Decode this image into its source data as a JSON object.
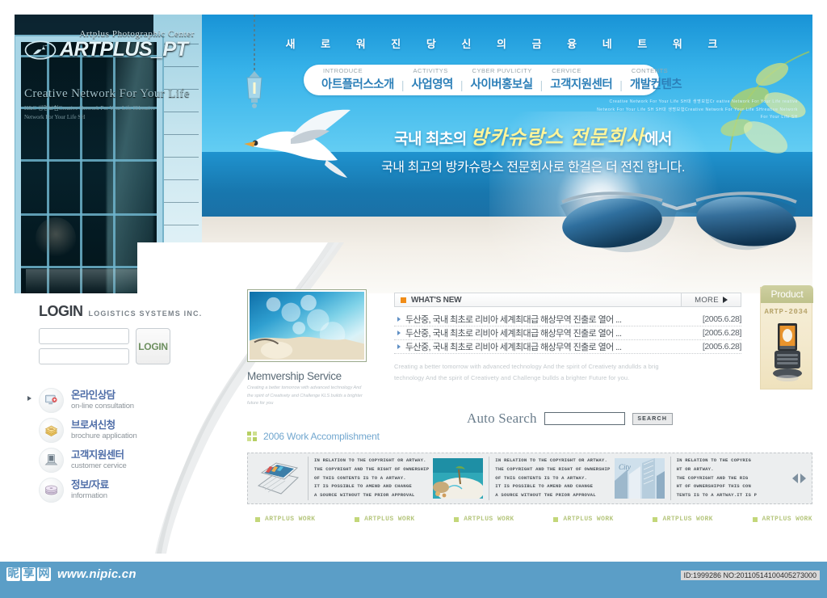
{
  "site": {
    "left_photo": {
      "sub_top": "Artplus Photographic Center",
      "brand": "ARTPLUS_PT",
      "tagline": "Creative Network For Your Life",
      "micro": "H&C 생명보험Creative Network For Your Life SHreative Network For Your Life SH"
    },
    "hero": {
      "top_title": "새 로 워 진  당 신 의  금 융  네 트 워 크",
      "micro": "Creative Network For Your Life SH대 생명보험Cr eative Network For Your Life   reative Network For Your Life SH SH대 생명보험Creative Network For Your Life SHreative Network For Your Life SH",
      "copy_line1_pre": "국내 최초의 ",
      "copy_line1_accent": "방카슈랑스 전문회사",
      "copy_line1_post": "에서",
      "copy_line2": "국내 최고의 방카슈랑스 전문회사로 한걸은 더 전진 합니다."
    },
    "nav": [
      {
        "en": "INTRODUCE",
        "ko": "아트플러스소개"
      },
      {
        "en": "ACTIVITYS",
        "ko": "사업영역"
      },
      {
        "en": "CYBER PUVLICITY",
        "ko": "사이버홍보실"
      },
      {
        "en": "CERVICE",
        "ko": "고객지원센터"
      },
      {
        "en": "CONTENTS",
        "ko": "개발컨텐츠"
      }
    ],
    "nav_separator": "|",
    "login": {
      "title": "LOGIN",
      "subtitle": "LOGISTICS SYSTEMS INC.",
      "id_value": "",
      "id_placeholder": "",
      "pw_value": "",
      "pw_placeholder": "",
      "button": "LOGIN"
    },
    "quickmenu": [
      {
        "ko": "온라인상담",
        "en": "on-line consultation",
        "icon": "monitor-icon"
      },
      {
        "ko": "브로셔신청",
        "en": "brochure application",
        "icon": "book-icon"
      },
      {
        "ko": "고객지원센터",
        "en": " customer cervice",
        "icon": "laptop-icon"
      },
      {
        "ko": "정보/자료",
        "en": "information",
        "icon": "disc-icon"
      }
    ],
    "membership": {
      "title": "Memvership Service",
      "desc": "Creating a better tomorrow with advanced technology And the spirit of Creativety and Challenge  KLS builds a brighter future for you"
    },
    "whats_new": {
      "title": "WHAT'S NEW",
      "more": "MORE",
      "items": [
        {
          "text": "두산중, 국내 최초로 리비아 세계최대급 해상무역 진출로 열어 ...",
          "date": "[2005.6.28]"
        },
        {
          "text": "두산중, 국내 최초로 리비아 세계최대급 해상무역 진출로 열어 ...",
          "date": "[2005.6.28]"
        },
        {
          "text": "두산중, 국내 최초로 리비아 세계최대급 해상무역 진출로 열어 ...",
          "date": "[2005.6.28]"
        }
      ],
      "paragraph": "Creating a better tomorrow with advanced technology And the spirit of   Creativety andullds a brig\ntechnology And the spirit of   Creativety and Challenge   bullds a brighter Future for you."
    },
    "auto_search": {
      "label": "Auto Search",
      "value": "",
      "placeholder": "",
      "button": "SEARCH"
    },
    "work_section": {
      "title": "2006 Work Accomplishment"
    },
    "strip": {
      "full_text": "IN RELATION TO THE COPYRIGHT OR ARTWAY.\nTHE COPYRIGHT AND THE RIGHT OF OWNERSHIP\nOF THIS CONTENTS IS TO A ARTWAY.\nIT IS POSSIBLE TO AMEND AND CHANGE\nA SOURCE WITHOUT THE PRIOR APPROVAL",
      "clipped_text": "IN RELATION TO THE COPYRIG\nHT OR ARTWAY.\nTHE COPYRIGHT AND THE RIG\nHT OF OWNERSHIPOF THIS CON\nTENTS IS TO A ARTWAY.IT IS P",
      "images": [
        "laptop-image",
        "beach-image",
        "city-image"
      ]
    },
    "work_links": [
      "ARTPLUS WORK",
      "ARTPLUS WORK",
      "ARTPLUS WORK",
      "ARTPLUS WORK",
      "ARTPLUS WORK",
      "ARTPLUS WORK"
    ],
    "product": {
      "tab": "Product",
      "code": "ARTP-2034"
    },
    "footer": {
      "logo_chars": [
        "昵",
        "享",
        "网"
      ],
      "url": "www.nipic.cn",
      "id": "ID:1999286 NO:20110514100405273000"
    },
    "colors": {
      "sky_blue": "#36b2e9",
      "nav_blue": "#2c7fb8",
      "accent_orange": "#f08c18",
      "accent_yellow": "#fff59a",
      "link_green": "#b7c77f",
      "footer_blue": "#5b9ec7",
      "product_olive": "#bfc28c"
    }
  }
}
